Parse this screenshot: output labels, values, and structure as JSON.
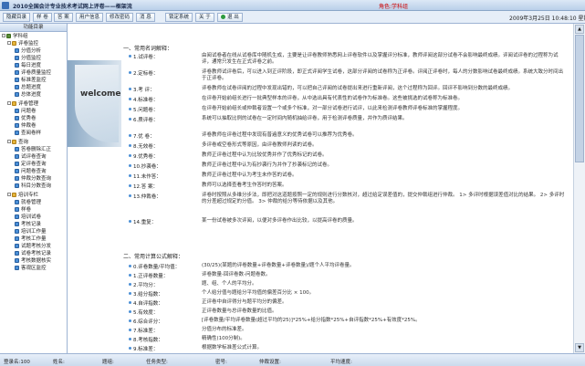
{
  "app": {
    "title": "2010全国会计专业技术考试网上评卷——框架流",
    "role": "角色:学科组",
    "datetime": "2009年3月25日  10:48:10  星期三"
  },
  "toolbar": {
    "buttons": [
      "隐藏目录",
      "样  卷",
      "答  案",
      "用户信息",
      "修改密码",
      "消  息",
      "锁定系统",
      "关  于"
    ],
    "exit": "退 出"
  },
  "sidebar": {
    "header": "功能目录",
    "items": [
      "学科组",
      "评卷监控",
      "分值分析",
      "分值监控",
      "每日进度",
      "评卷质量监控",
      "标准差监控",
      "总题进度",
      "总体进度",
      "评卷管理",
      "问题卷",
      "优秀卷",
      "仲裁卷",
      "查阅卷样",
      "查询",
      "答卷删除汇正",
      "试评卷查询",
      "定评卷查询",
      "问题卷查询",
      "仲裁分数查询",
      "科目分数查询",
      "培训专栏",
      "就卷管理",
      "样卷",
      "培训试卷",
      "考核记录",
      "培训工作量",
      "考核工作量",
      "试题考核分发",
      "试卷考核记录",
      "考核数据核实",
      "客观区监控"
    ]
  },
  "banner": {
    "text": "welcome"
  },
  "content": {
    "section1": "一、常用名词解释：",
    "terms": [
      {
        "label": "1.试评卷：",
        "desc": "由阅试卷者在线从试卷库中随机生成，主要是让评卷教师熟悉网上评卷软件以及掌握评分标准，教师评阅这部分试卷不会影响最终成绩。评阅试评卷的过程称为试评，通常只发生在正式评卷之前。"
      },
      {
        "label": "2.定标卷：",
        "desc": "评卷教师试评卷后，可以进入到正评阶段，即正式评阅学生试卷，这部分评阅的试卷称为正评卷。评阅正评卷时，每人的分数影响试卷最终成绩。系统大致分时间出于正评卷。"
      },
      {
        "label": "3.考  评：",
        "desc": "评卷教师在试卷评阅的过程中发现出错的，可以把自己评阅的试卷提出来进行重新评阅，这个过程称为回评。回评不影响到分数的最终成绩。"
      },
      {
        "label": "4.标准卷：",
        "desc": "在评卷开始前组长进行一批典型样本的评卷，从中选出具有代表性的试卷作为标准卷。这些被挑选的试卷称为标准卷。"
      },
      {
        "label": "5.问题卷：",
        "desc": "在评卷开始前组长或仲裁者设置一个或多个标准，对一部分试卷进行试评，以此来检测评卷教师评卷标准的掌握程度。"
      },
      {
        "label": "6.质评卷：",
        "desc": "系统可以抽取比例的试卷在一定时间内随机抽给评卷，用于检测评卷质量，并作为质评结果。"
      },
      {
        "label": "7.优  卷：",
        "desc": "评卷教师在评卷过程中发现有普遍意义的优秀试卷可以推荐为优秀卷。"
      },
      {
        "label": "8.无效卷：",
        "desc": "多评卷或空卷形式等原因，由评卷教师判读的试卷。"
      },
      {
        "label": "9.优秀卷：",
        "desc": "教师正评卷过程中认为比较优秀并作了优秀标记的试卷。"
      },
      {
        "label": "10.抄袭卷：",
        "desc": "教师正评卷过程中认为有抄袭行为并作了抄袭标记的试卷。"
      },
      {
        "label": "11.未作答：",
        "desc": "教师正评卷过程中认为考生未作答的试卷。"
      },
      {
        "label": "12.答  案：",
        "desc": "教师可以选择查看考生作答时的答案。"
      },
      {
        "label": "13.仲裁卷：",
        "desc": "评卷时按照从多维分步法，即把对这道题按照一定的规则进行分数核对，超过给定误差值的，提交仲裁组进行仲裁。  1> 多评时根据误差值对比的结果。  2> 多评时的分差超过规定的分值。  3> 仲裁的给分等待依据以及其他。"
      },
      {
        "label": "14.重复：",
        "desc": "某一份试卷被多次评阅，以便对多评卷作出比较，以提高评卷的质量。"
      }
    ],
    "section2": "二、常用计算公式解释：",
    "formulas": [
      {
        "label": "0.评卷数量/平均值：",
        "desc": "(30/25)(某题的评卷数量+评卷数量+评卷数量)/题个人平均评卷量。"
      },
      {
        "label": "1.正评卷数量：",
        "desc": "评卷数量-回评卷数-问题卷数。"
      },
      {
        "label": "2.平均分：",
        "desc": "题、组、个人的平均分。"
      },
      {
        "label": "3.给分指数：",
        "desc": "个人给分值与题给分平均值的偏差百分比 × 100。"
      },
      {
        "label": "4.自评指数：",
        "desc": "正评卷中自评得分与题平均分的偏差。"
      },
      {
        "label": "5.有效度：",
        "desc": "正评卷数量与总评卷数量的比值。"
      },
      {
        "label": "6.综合评分：",
        "desc": "[评卷数量/平均评卷数量(超过平均的25)]*25%+给分指数*25%+自评指数*25%+有效度*25%。"
      },
      {
        "label": "7.标准差：",
        "desc": "分值分布的标准差。"
      },
      {
        "label": "8.考核指数：",
        "desc": "精确性(100分制)。"
      },
      {
        "label": "9.标准差：",
        "desc": "根据数学标准差公式计算。"
      }
    ]
  },
  "status": {
    "items": [
      "登录名:100",
      "姓名:",
      "题组:",
      "任务类型:",
      "密号:",
      "仲裁设置:",
      "平均速度:"
    ]
  }
}
